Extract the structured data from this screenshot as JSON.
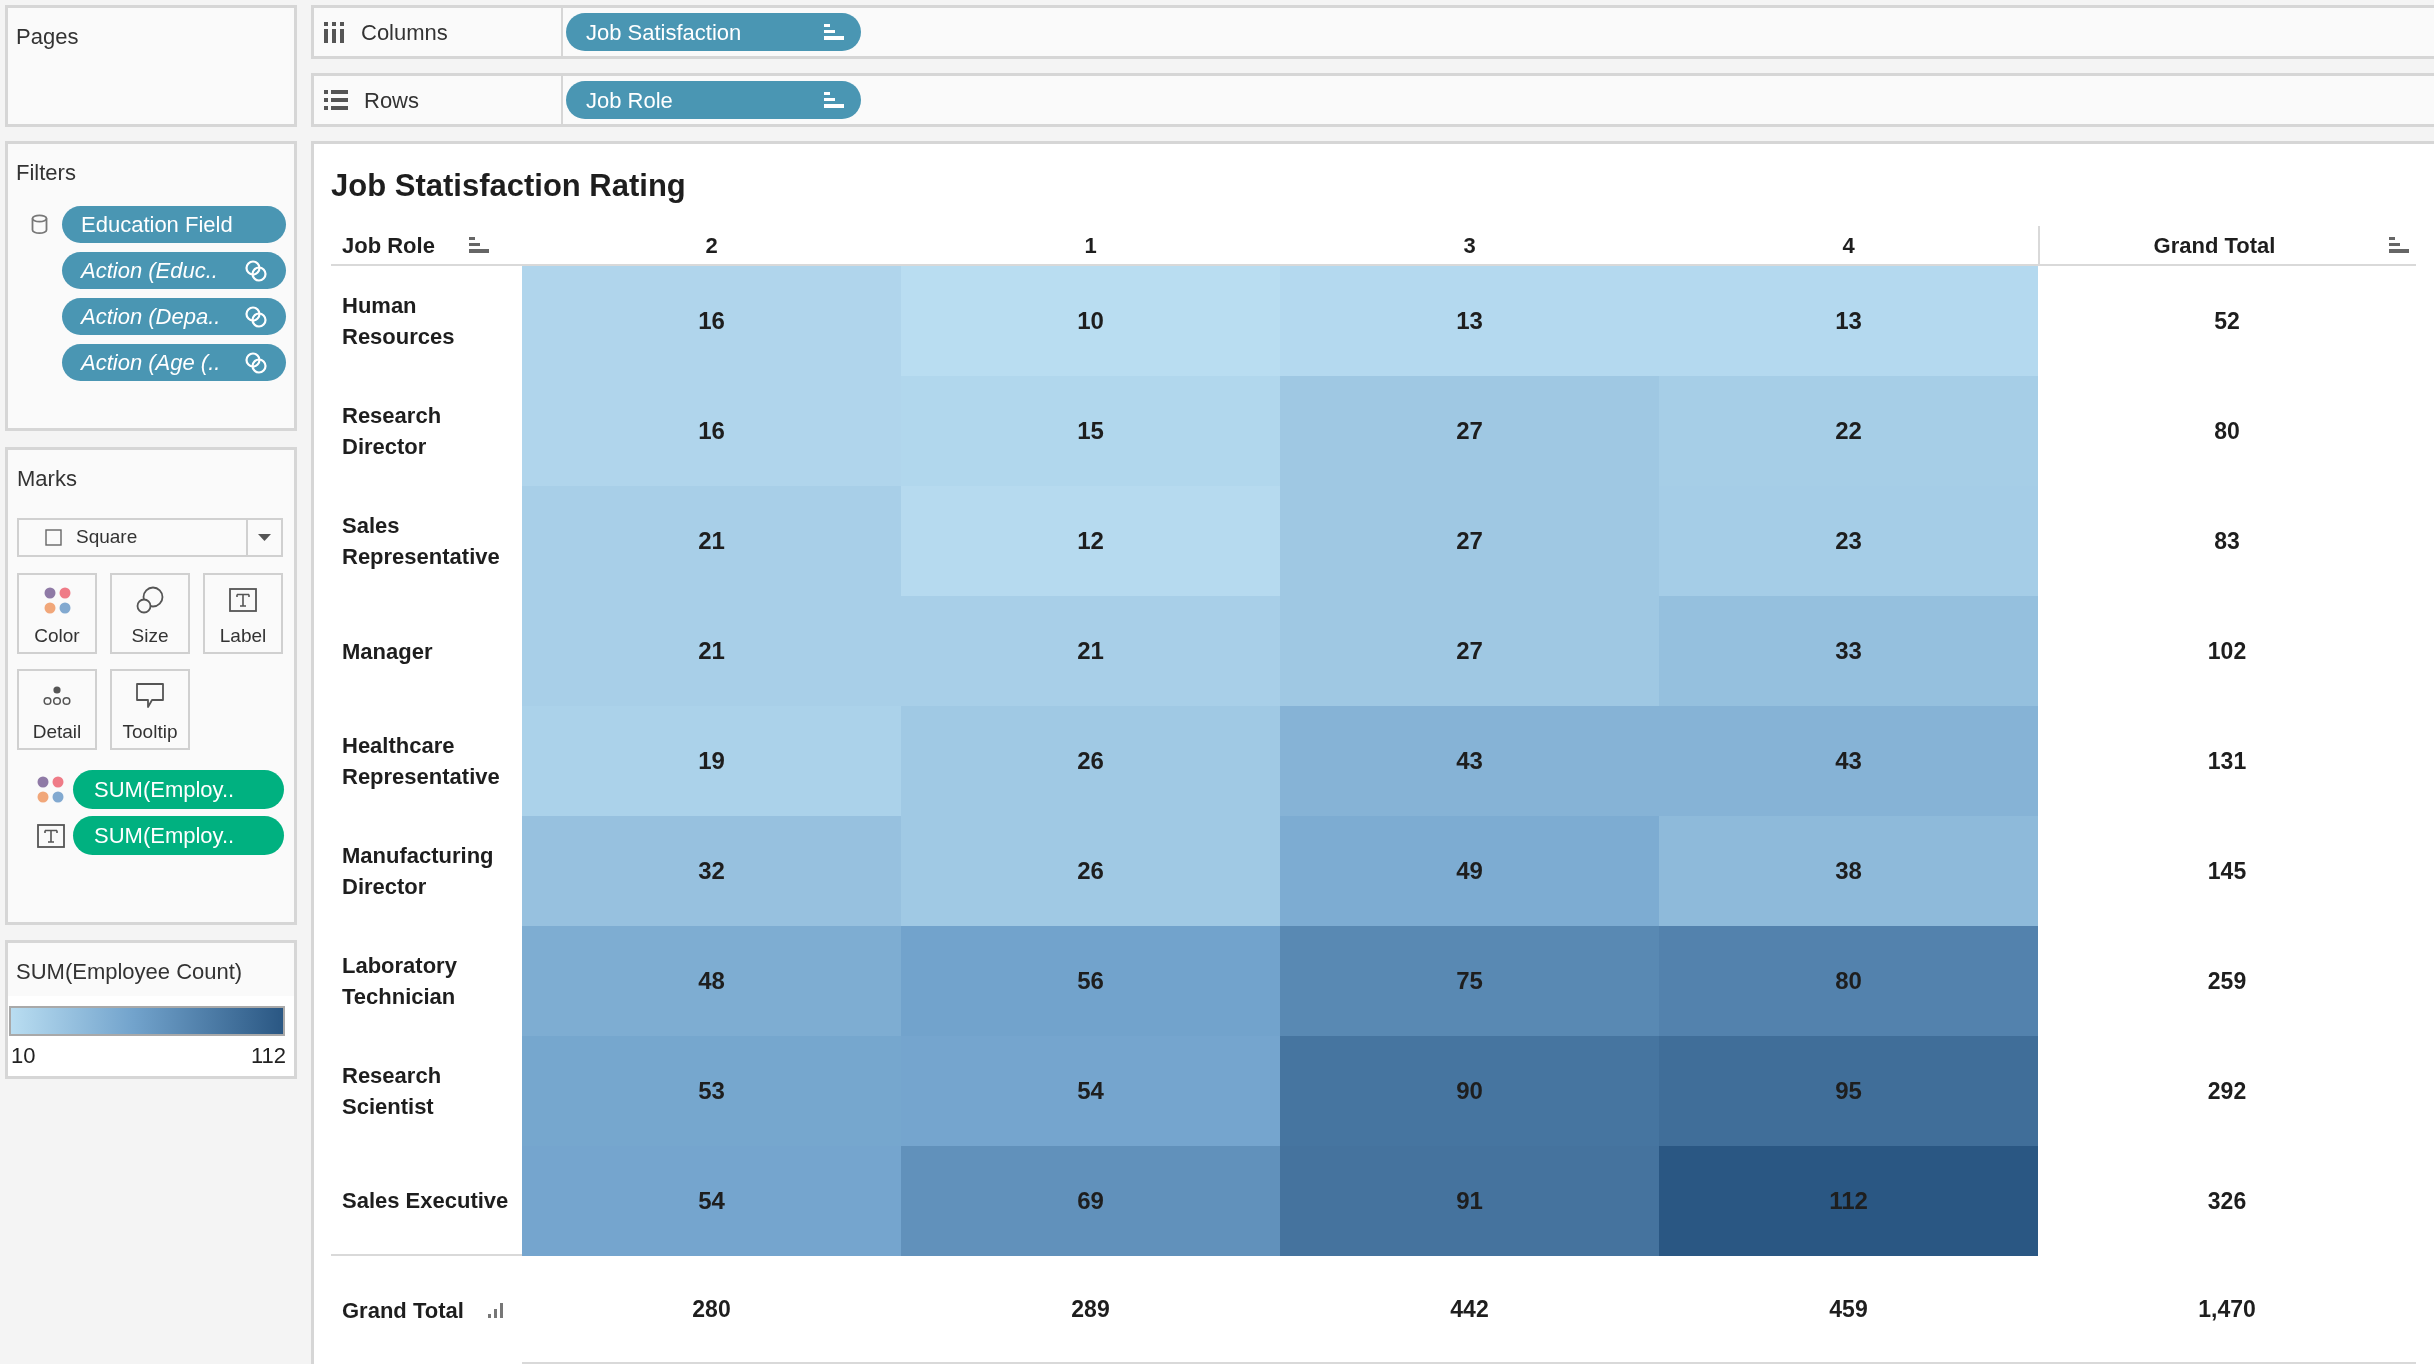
{
  "pages_card": {
    "title": "Pages"
  },
  "filters_card": {
    "title": "Filters",
    "pills": [
      {
        "kind": "field",
        "label": "Education Field"
      },
      {
        "kind": "action",
        "label": "Action (Educ.."
      },
      {
        "kind": "action",
        "label": "Action (Depa.."
      },
      {
        "kind": "action",
        "label": "Action (Age (.."
      }
    ]
  },
  "marks_card": {
    "title": "Marks",
    "mark_type": "Square",
    "buttons": [
      {
        "kind": "color",
        "label": "Color"
      },
      {
        "kind": "size",
        "label": "Size"
      },
      {
        "kind": "label",
        "label": "Label"
      },
      {
        "kind": "detail",
        "label": "Detail"
      },
      {
        "kind": "tooltip",
        "label": "Tooltip"
      }
    ],
    "pills": [
      {
        "kind": "color",
        "label": "SUM(Employ.."
      },
      {
        "kind": "label",
        "label": "SUM(Employ.."
      }
    ]
  },
  "legend_card": {
    "title": "SUM(Employee Count)",
    "min_label": "10",
    "max_label": "112"
  },
  "shelves": [
    {
      "kind": "columns",
      "label": "Columns",
      "pill": "Job Satisfaction"
    },
    {
      "kind": "rows",
      "label": "Rows",
      "pill": "Job Role"
    }
  ],
  "view": {
    "chart_data": [
      {
        "type": "heatmap",
        "title": "Job Statisfaction Rating",
        "ylabel": "Job Role",
        "categories": [
          "2",
          "1",
          "3",
          "4"
        ],
        "y_categories": [
          "Human Resources",
          "Research Director",
          "Sales Representative",
          "Manager",
          "Healthcare Representative",
          "Manufacturing Director",
          "Laboratory Technician",
          "Research Scientist",
          "Sales Executive"
        ],
        "cells": [
          [
            16,
            10,
            13,
            13
          ],
          [
            16,
            15,
            27,
            22
          ],
          [
            21,
            12,
            27,
            23
          ],
          [
            21,
            21,
            27,
            33
          ],
          [
            19,
            26,
            43,
            43
          ],
          [
            32,
            26,
            49,
            38
          ],
          [
            48,
            56,
            75,
            80
          ],
          [
            53,
            54,
            90,
            95
          ],
          [
            54,
            69,
            91,
            112
          ]
        ],
        "data_labels": true
      }
    ],
    "grand_total_column": {
      "header": "Grand Total",
      "values": [
        "52",
        "80",
        "83",
        "102",
        "131",
        "145",
        "259",
        "292",
        "326"
      ]
    },
    "grand_total_row": {
      "label": "Grand Total",
      "values": [
        "280",
        "289",
        "442",
        "459"
      ],
      "total": "1,470"
    }
  }
}
